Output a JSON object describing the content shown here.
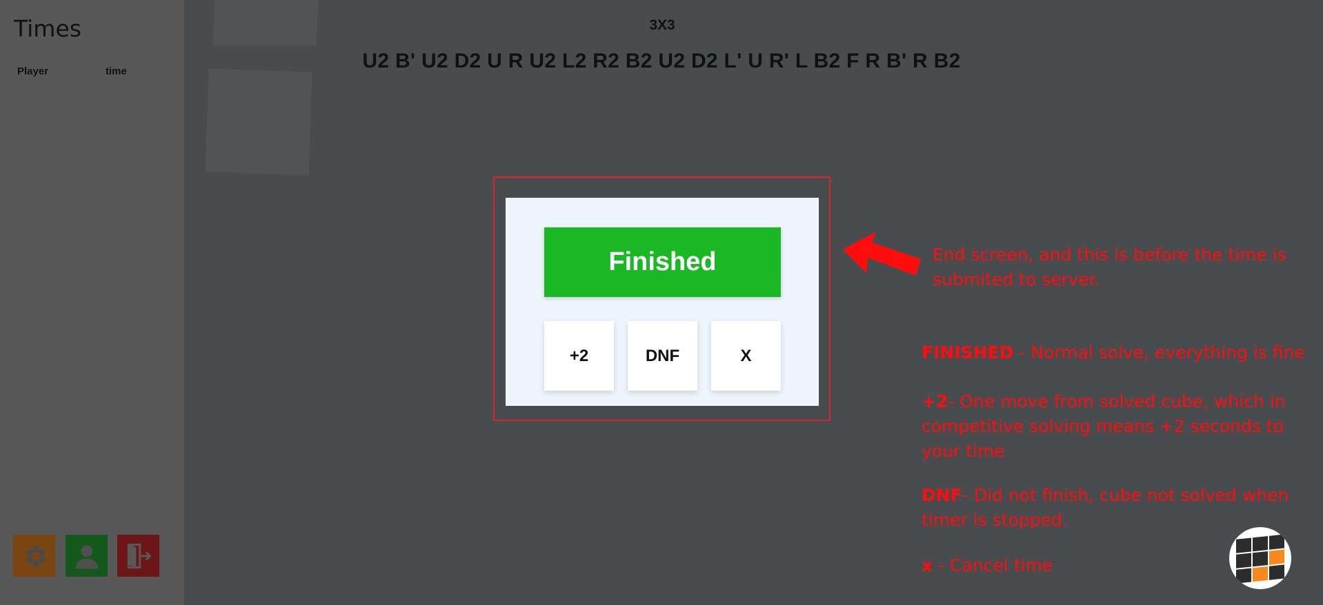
{
  "sidebar": {
    "title": "Times",
    "columns": {
      "player": "Player",
      "time": "time"
    },
    "buttons": [
      {
        "icon": "gear-icon",
        "color": "#7a4510"
      },
      {
        "icon": "user-icon",
        "color": "#14581c"
      },
      {
        "icon": "logout-icon",
        "color": "#6d1618"
      }
    ]
  },
  "header": {
    "event": "3X3",
    "scramble": "U2 B' U2 D2 U R U2 L2 R2 B2 U2 D2 L' U R' L B2 F R B' R B2"
  },
  "dialog": {
    "finished_label": "Finished",
    "plus2_label": "+2",
    "dnf_label": "DNF",
    "x_label": "X",
    "finished_color": "#1bb826",
    "highlight_color": "#e0232b"
  },
  "annotations": {
    "end_screen": "End screen, and this is before the time is submited to server.",
    "finished": {
      "key": "FINISHED",
      "text": " - Normal solve, everything is fine"
    },
    "plus2": {
      "key": "+2",
      "text": "- One move from solved cube, which in competitive solving means +2 seconds to your time"
    },
    "dnf": {
      "key": "DNF",
      "text": "- Did not finish, cube not solved when timer is stopped."
    },
    "x": {
      "key": "x",
      "text": " - Cancel time"
    },
    "color": "#ff0d0d"
  },
  "logo": {
    "icon": "cube-logo-icon"
  }
}
